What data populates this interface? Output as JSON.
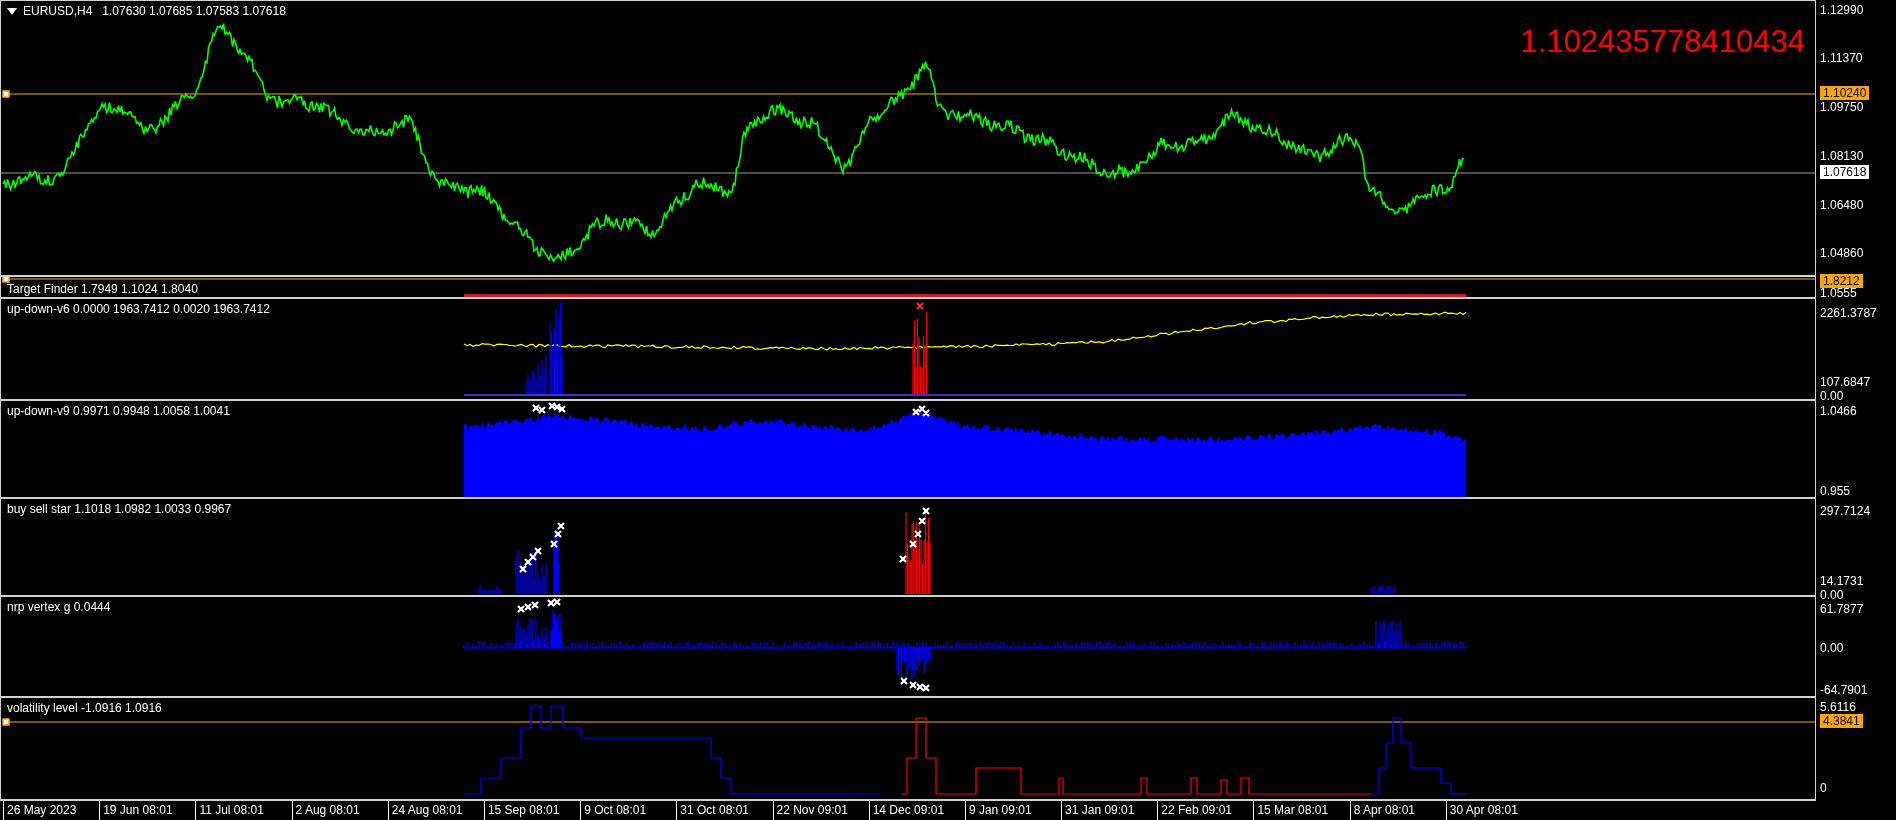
{
  "main_panel": {
    "symbol": "EURUSD,H4",
    "ohlc": "1.07630 1.07685 1.07583 1.07618",
    "overlay_value": "1.102435778410434",
    "axis_labels": [
      {
        "text": "1.12990",
        "kind": "tick"
      },
      {
        "text": "1.11370",
        "kind": "tick"
      },
      {
        "text": "1.10240",
        "kind": "orange"
      },
      {
        "text": "1.09750",
        "kind": "tick"
      },
      {
        "text": "1.08130",
        "kind": "tick"
      },
      {
        "text": "1.07618",
        "kind": "white"
      },
      {
        "text": "1.06480",
        "kind": "tick"
      },
      {
        "text": "1.04860",
        "kind": "tick"
      }
    ]
  },
  "indicator_panels": [
    {
      "label": "Target Finder 1.7949 1.1024 1.8040",
      "axis_labels": [
        {
          "text": "1.8212",
          "kind": "orange"
        },
        {
          "text": "1.0555",
          "kind": "tick"
        }
      ]
    },
    {
      "label": "up-down-v6 0.0000 1963.7412 0.0020 1963.7412",
      "axis_labels": [
        {
          "text": "2261.3787",
          "kind": "tick"
        },
        {
          "text": "107.6847",
          "kind": "tick"
        },
        {
          "text": "0.00",
          "kind": "tick"
        }
      ]
    },
    {
      "label": "up-down-v9 0.9971 0.9948 1.0058 1.0041",
      "axis_labels": [
        {
          "text": "1.0466",
          "kind": "tick"
        },
        {
          "text": "0.955",
          "kind": "tick"
        }
      ]
    },
    {
      "label": "buy sell star 1.1018 1.0982 1.0033 0.9967",
      "axis_labels": [
        {
          "text": "297.7124",
          "kind": "tick"
        },
        {
          "text": "14.1731",
          "kind": "tick"
        },
        {
          "text": "0.00",
          "kind": "tick"
        }
      ]
    },
    {
      "label": "nrp vertex g 0.0444",
      "axis_labels": [
        {
          "text": "61.7877",
          "kind": "tick"
        },
        {
          "text": "0.00",
          "kind": "tick"
        },
        {
          "text": "-64.7901",
          "kind": "tick"
        }
      ]
    },
    {
      "label": "volatility level -1.0916 1.0916",
      "axis_labels": [
        {
          "text": "5.6116",
          "kind": "tick"
        },
        {
          "text": "4.3841",
          "kind": "orange"
        },
        {
          "text": "0",
          "kind": "tick"
        }
      ]
    }
  ],
  "time_axis": [
    "26 May 2023",
    "19 Jun 08:01",
    "11 Jul 08:01",
    "2 Aug 08:01",
    "24 Aug 08:01",
    "15 Sep 08:01",
    "9 Oct 08:01",
    "31 Oct 08:01",
    "22 Nov 09:01",
    "14 Dec 09:01",
    "9 Jan 09:01",
    "31 Jan 09:01",
    "22 Feb 09:01",
    "15 Mar 08:01",
    "8 Apr 08:01",
    "30 Apr 08:01"
  ]
}
